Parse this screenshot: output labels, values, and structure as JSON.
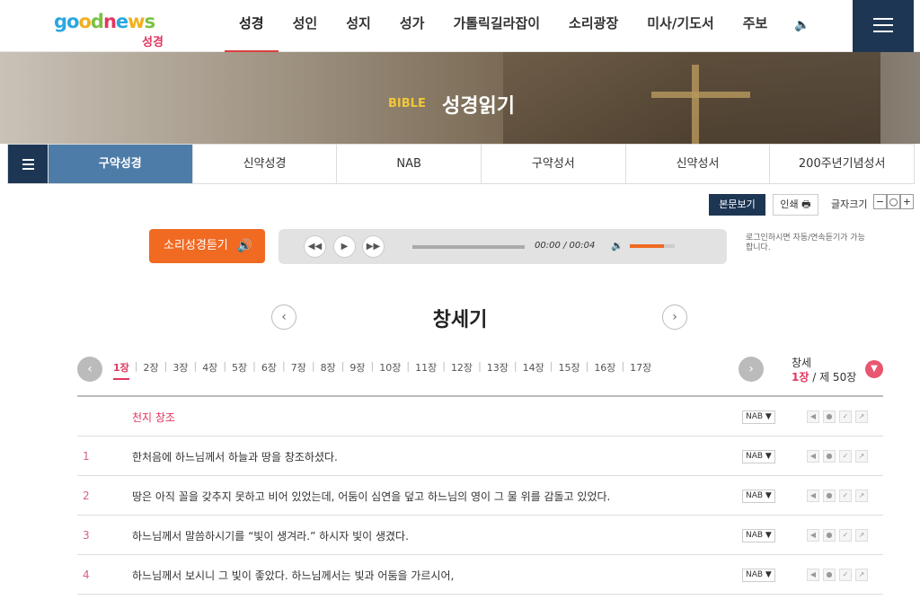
{
  "logo": {
    "main": "goodnews",
    "sub": "성경"
  },
  "nav": {
    "items": [
      {
        "label": "성경",
        "active": true
      },
      {
        "label": "성인"
      },
      {
        "label": "성지"
      },
      {
        "label": "성가"
      },
      {
        "label": "가톨릭길라잡이"
      },
      {
        "label": "소리광장"
      },
      {
        "label": "미사/기도서"
      },
      {
        "label": "주보"
      }
    ]
  },
  "hero": {
    "eng": "BIBLE",
    "title": "성경읽기"
  },
  "tabs": [
    {
      "label": "구약성경",
      "active": true
    },
    {
      "label": "신약성경"
    },
    {
      "label": "NAB"
    },
    {
      "label": "구약성서"
    },
    {
      "label": "신약성서"
    },
    {
      "label": "200주년기념성서"
    }
  ],
  "toolbar": {
    "view": "본문보기",
    "print": "인쇄",
    "font_size": "글자크기",
    "minus": "−",
    "reset": "○",
    "plus": "+"
  },
  "audio": {
    "button": "소리성경듣기",
    "time": "00:00 / 00:04",
    "volume_fraction": 0.75,
    "login_note": "로그인하시면 자동/연속듣기가 가능합니다."
  },
  "book": {
    "title": "창세기"
  },
  "chapters": [
    "1장",
    "2장",
    "3장",
    "4장",
    "5장",
    "6장",
    "7장",
    "8장",
    "9장",
    "10장",
    "11장",
    "12장",
    "13장",
    "14장",
    "15장",
    "16장",
    "17장"
  ],
  "chapter_info": {
    "book_short": "창세",
    "current": "1장",
    "total": "/ 제 50장"
  },
  "verses": [
    {
      "num": "",
      "text": "천지 창조",
      "heading": true,
      "version": "NAB ▼"
    },
    {
      "num": "1",
      "text": "한처음에 하느님께서 하늘과 땅을 창조하셨다.",
      "version": "NAB ▼"
    },
    {
      "num": "2",
      "text": "땅은 아직 꼴을 갖추지 못하고 비어 있었는데, 어둠이 심연을 덮고 하느님의 영이 그 물 위를 감돌고 있었다.",
      "version": "NAB ▼"
    },
    {
      "num": "3",
      "text": "하느님께서 말씀하시기를 “빛이 생겨라.” 하시자 빛이 생겼다.",
      "version": "NAB ▼"
    },
    {
      "num": "4",
      "text": "하느님께서 보시니 그 빛이 좋았다. 하느님께서는 빛과 어둠을 가르시어,",
      "version": "NAB ▼"
    }
  ]
}
